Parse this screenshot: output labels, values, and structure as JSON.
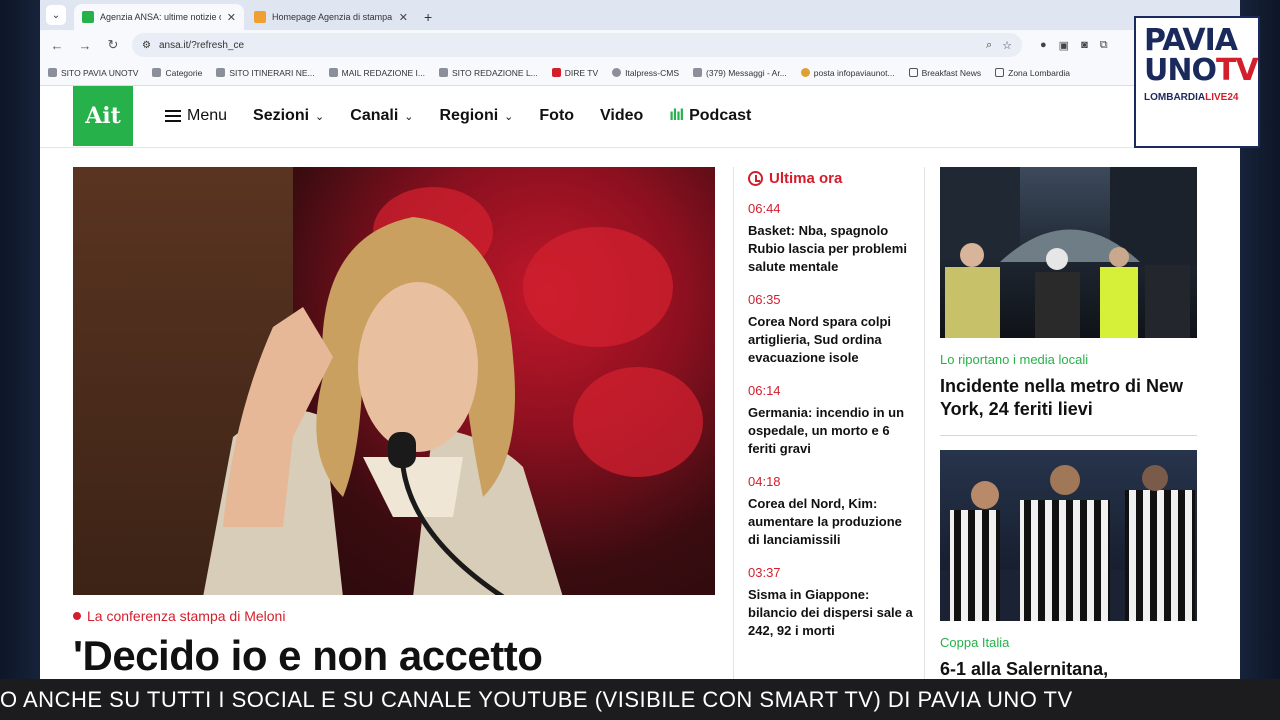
{
  "browser": {
    "tabs": [
      {
        "title": "Agenzia ANSA: ultime notizie d",
        "active": true,
        "fav_color": "#26b14a"
      },
      {
        "title": "Homepage Agenzia di stampa",
        "active": false,
        "fav_color": "#f0a030"
      }
    ],
    "url": "ansa.it/?refresh_ce",
    "bookmarks": [
      "SITO PAVIA UNOTV",
      "Categorie",
      "SITO ITINERARI NE...",
      "MAIL REDAZIONE I...",
      "SITO REDAZIONE L...",
      "DIRE TV",
      "Italpress-CMS",
      "(379) Messaggi - Ar...",
      "posta infopaviaunot...",
      "Breakfast News",
      "Zona Lombardia"
    ]
  },
  "site": {
    "logo": "Ait",
    "nav": {
      "menu": "Menu",
      "sezioni": "Sezioni",
      "canali": "Canali",
      "regioni": "Regioni",
      "foto": "Foto",
      "video": "Video",
      "podcast": "Podcast"
    }
  },
  "main": {
    "kicker": "La conferenza stampa di Meloni",
    "headline": "'Decido io e non accetto"
  },
  "ultima_ora": {
    "title": "Ultima ora",
    "items": [
      {
        "time": "06:44",
        "text": "Basket: Nba, spagnolo Rubio lascia per problemi salute mentale"
      },
      {
        "time": "06:35",
        "text": "Corea Nord spara colpi artiglieria, Sud ordina evacuazione isole"
      },
      {
        "time": "06:14",
        "text": "Germania: incendio in un ospedale, un morto e 6 feriti gravi"
      },
      {
        "time": "04:18",
        "text": "Corea del Nord, Kim: aumentare la produzione di lanciamissili"
      },
      {
        "time": "03:37",
        "text": "Sisma in Giappone: bilancio dei dispersi sale a 242, 92 i morti"
      }
    ]
  },
  "side_news": [
    {
      "tag": "Lo riportano i media locali",
      "title": "Incidente nella metro di New York, 24 feriti lievi"
    },
    {
      "tag": "Coppa Italia",
      "title": "6-1 alla Salernitana,"
    }
  ],
  "overlay": {
    "logo_line1": "PAVIA",
    "logo_line2": "UNO",
    "logo_tv": "TV",
    "logo_sub": "LOMBARDIA",
    "logo_sub_live": "LIVE24",
    "ticker": "O ANCHE SU TUTTI I SOCIAL E SU CANALE YOUTUBE (VISIBILE CON SMART TV) DI PAVIA UNO TV"
  }
}
